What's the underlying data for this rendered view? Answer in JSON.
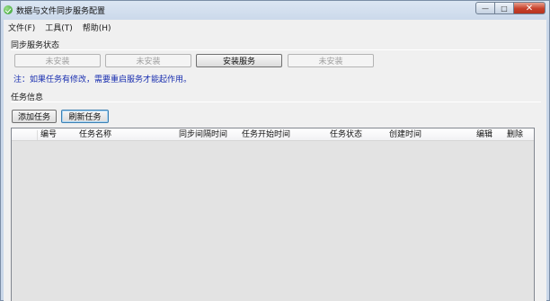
{
  "window": {
    "title": "数据与文件同步服务配置",
    "caption": {
      "minimize": "—",
      "maximize": "□",
      "close": "✕"
    }
  },
  "menu": [
    {
      "label": "文件(F)"
    },
    {
      "label": "工具(T)"
    },
    {
      "label": "帮助(H)"
    }
  ],
  "sync_service": {
    "title": "同步服务状态",
    "buttons": [
      {
        "label": "未安装",
        "enabled": false
      },
      {
        "label": "未安装",
        "enabled": false
      },
      {
        "label": "安装服务",
        "enabled": true
      },
      {
        "label": "未安装",
        "enabled": false
      }
    ],
    "note": "注：如果任务有修改，需要重启服务才能起作用。"
  },
  "task_info": {
    "title": "任务信息",
    "add_button": "添加任务",
    "refresh_button": "刷新任务"
  },
  "table": {
    "columns": [
      "编号",
      "任务名称",
      "同步间隔时间",
      "任务开始时间",
      "任务状态",
      "创建时间",
      "编辑",
      "删除"
    ],
    "rows": []
  },
  "colors": {
    "note_text": "#1a2fb0",
    "list_background": "#e3e3e3",
    "close_button": "#c7402a"
  }
}
